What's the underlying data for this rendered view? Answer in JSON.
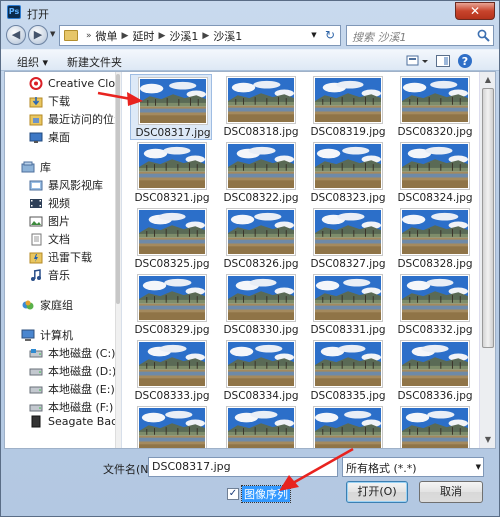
{
  "window": {
    "title": "打开",
    "app_icon": "Ps",
    "close_glyph": "✕"
  },
  "address": {
    "breadcrumbs": [
      "微单",
      "延时",
      "沙溪1",
      "沙溪1"
    ],
    "search_placeholder": "搜索 沙溪1"
  },
  "toolbar": {
    "organize": "组织 ▾",
    "new_folder": "新建文件夹"
  },
  "sidebar": {
    "items": [
      {
        "label": "Creative Cloud",
        "icon": "creative-cloud-icon"
      },
      {
        "label": "下载",
        "icon": "download-folder-icon"
      },
      {
        "label": "最近访问的位置",
        "icon": "recent-places-icon"
      },
      {
        "label": "桌面",
        "icon": "desktop-icon"
      },
      {
        "label": "库",
        "icon": "library-icon"
      },
      {
        "label": "暴风影视库",
        "icon": "media-library-icon"
      },
      {
        "label": "视频",
        "icon": "video-icon"
      },
      {
        "label": "图片",
        "icon": "pictures-icon"
      },
      {
        "label": "文档",
        "icon": "documents-icon"
      },
      {
        "label": "迅雷下载",
        "icon": "thunder-download-icon"
      },
      {
        "label": "音乐",
        "icon": "music-icon"
      },
      {
        "label": "家庭组",
        "icon": "homegroup-icon"
      },
      {
        "label": "计算机",
        "icon": "computer-icon"
      },
      {
        "label": "本地磁盘 (C:)",
        "icon": "drive-icon"
      },
      {
        "label": "本地磁盘 (D:)",
        "icon": "drive-icon"
      },
      {
        "label": "本地磁盘 (E:)",
        "icon": "drive-icon"
      },
      {
        "label": "本地磁盘 (F:)",
        "icon": "drive-icon"
      },
      {
        "label": "Seagate Backup",
        "icon": "external-drive-icon"
      }
    ]
  },
  "files": [
    "DSC08317.jpg",
    "DSC08318.jpg",
    "DSC08319.jpg",
    "DSC08320.jpg",
    "DSC08321.jpg",
    "DSC08322.jpg",
    "DSC08323.jpg",
    "DSC08324.jpg",
    "DSC08325.jpg",
    "DSC08326.jpg",
    "DSC08327.jpg",
    "DSC08328.jpg",
    "DSC08329.jpg",
    "DSC08330.jpg",
    "DSC08331.jpg",
    "DSC08332.jpg",
    "DSC08333.jpg",
    "DSC08334.jpg",
    "DSC08335.jpg",
    "DSC08336.jpg",
    "",
    "",
    "",
    ""
  ],
  "bottom": {
    "filename_label": "文件名(N):",
    "filename_value": "DSC08317.jpg",
    "filetype_value": "所有格式 (*.*)",
    "image_sequence_label": "图像序列",
    "image_sequence_checked": true,
    "check_glyph": "✓",
    "open_button": "打开(O)",
    "cancel_button": "取消"
  },
  "colors": {
    "annotation_arrow": "#e8231f",
    "selection": "#dde9f7"
  }
}
